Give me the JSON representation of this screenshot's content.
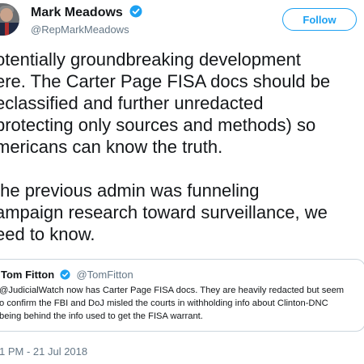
{
  "author": {
    "name": "Mark Meadows",
    "handle": "@RepMarkMeadows"
  },
  "follow_label": "Follow",
  "tweet_text": "otentially groundbreaking development\nere. The Carter Page FISA docs should be\neclassified and further unredacted\nprotecting only sources and methods) so\nmericans can know the truth.\n\nthe previous admin was funneling\nampaign research toward surveillance, we\need to know.",
  "quoted_tweet": {
    "name": "Tom Fitton",
    "handle": "@TomFitton",
    "text": "@JudicialWatch now has Carter Page FISA docs. They are heavily redacted but seem\no confirm the FBI and DoJ misled the courts in withholding info about Clinton-DNC\nbeing behind the info used to get the FISA warrant."
  },
  "timestamp": "1 PM - 21 Jul 2018",
  "colors": {
    "accent": "#1da1f2",
    "secondary_text": "#657786",
    "border": "#ccd6dd"
  },
  "icons": {
    "verified": "verified-badge-icon"
  }
}
